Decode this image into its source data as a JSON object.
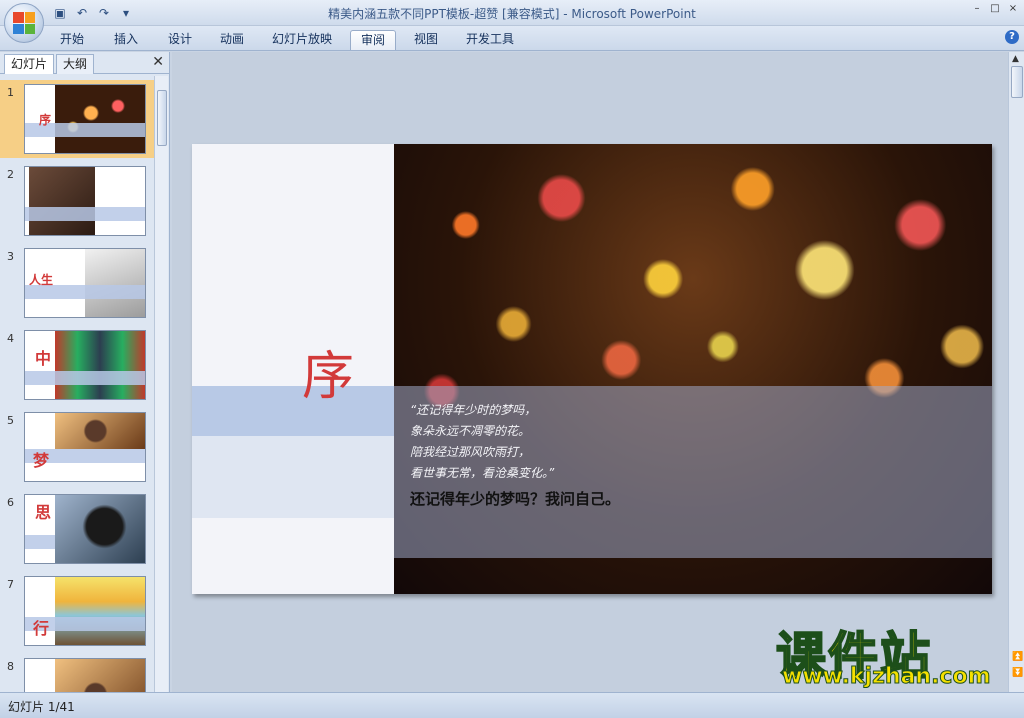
{
  "window": {
    "title": "精美内涵五款不同PPT模板-超赞 [兼容模式] - Microsoft PowerPoint",
    "controls": [
      "–",
      "□",
      "×"
    ]
  },
  "quick_access": {
    "save_icon": "save-icon",
    "undo_icon": "undo-icon",
    "redo_icon": "redo-icon",
    "customize_icon": "customize-icon"
  },
  "ribbon": {
    "tabs": [
      "开始",
      "插入",
      "设计",
      "动画",
      "幻灯片放映",
      "审阅",
      "视图",
      "开发工具"
    ],
    "active_tab": "审阅"
  },
  "left_pane": {
    "tabs": [
      "幻灯片",
      "大纲"
    ],
    "active_tab": "幻灯片",
    "thumbnails": [
      {
        "number": "1",
        "glyph": "序"
      },
      {
        "number": "2",
        "glyph": ""
      },
      {
        "number": "3",
        "glyph": "人生"
      },
      {
        "number": "4",
        "glyph": "中"
      },
      {
        "number": "5",
        "glyph": "梦"
      },
      {
        "number": "6",
        "glyph": "思"
      },
      {
        "number": "7",
        "glyph": "行"
      },
      {
        "number": "8",
        "glyph": ""
      }
    ]
  },
  "slide": {
    "title_char": "序",
    "poem_lines": [
      "“还记得年少时的梦吗，",
      "象朵永远不凋零的花。",
      "陪我经过那风吹雨打，",
      "看世事无常，看沧桑变化。”"
    ],
    "highlight": "还记得年少的梦吗？我问自己。"
  },
  "watermark": {
    "chinese": "课件站",
    "url": "www.kjzhan.com"
  },
  "status": {
    "slide_info": "幻灯片 1/41"
  },
  "colors": {
    "accent_red": "#d23a3a",
    "selected_thumb": "#f6cf86",
    "watermark_yellow": "#f5e000"
  }
}
